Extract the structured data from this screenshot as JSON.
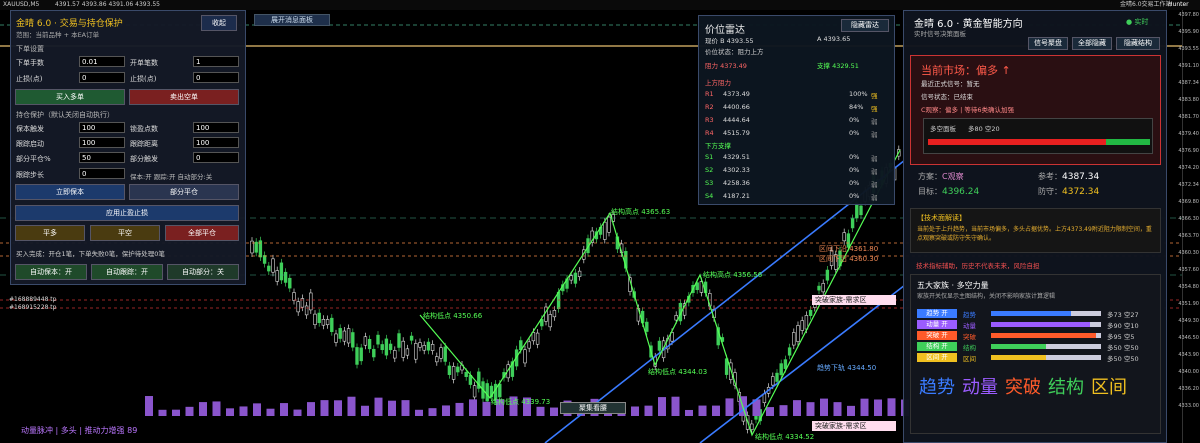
{
  "top_bar": {
    "symbol": "XAUUSD,M5",
    "ohlc": "4391.57 4393.86 4391.06 4393.55",
    "right_text": "金晴6.0交易工作站",
    "user": "Hunter"
  },
  "price_axis": [
    "4397.80",
    "4395.90",
    "4393.55",
    "4391.10",
    "4387.34",
    "4383.80",
    "4381.70",
    "4379.40",
    "4376.90",
    "4374.20",
    "4372.34",
    "4369.80",
    "4366.30",
    "4363.70",
    "4360.30",
    "4357.60",
    "4354.80",
    "4351.90",
    "4349.30",
    "4346.50",
    "4343.90",
    "4340.00",
    "4336.20",
    "4333.00"
  ],
  "left_panel": {
    "title": "金晴 6.0 · 交易与持仓保护",
    "subtitle": "范围：当前品种 + 本EA订单",
    "collapse_btn": "收起",
    "order_section": "下单设置",
    "lot_label": "下单手数",
    "lot_value": "0.01",
    "count_label": "开单笔数",
    "count_value": "1",
    "sl_label": "止损(点)",
    "sl_value": "0",
    "tp_label": "止损(点)",
    "tp_value": "0",
    "buy_btn": "买入多单",
    "sell_btn": "卖出空单",
    "protect_section": "持仓保护（默认关闭自动执行）",
    "be_trigger_label": "保本触发",
    "be_trigger_value": "100",
    "lock_label": "锁盈点数",
    "lock_value": "100",
    "trail_start_label": "跟踪启动",
    "trail_start_value": "100",
    "trail_dist_label": "跟踪距离",
    "trail_dist_value": "100",
    "partial_pct_label": "部分平仓%",
    "partial_pct_value": "50",
    "partial_trigger_label": "部分触发",
    "partial_trigger_value": "0",
    "trail_step_label": "跟踪步长",
    "trail_step_value": "0",
    "status_line": "保本:开 跟踪:开 自动部分:关",
    "be_btn": "立即保本",
    "partial_btn": "部分平仓",
    "apply_btn": "应用止盈止损",
    "close_long": "平多",
    "close_short": "平空",
    "close_all": "全部平仓",
    "log": "买入完成：开仓1笔，下单失败0笔，保护待处理0笔",
    "auto_be": "自动保本：开",
    "auto_trail": "自动跟踪：开",
    "auto_partial": "自动部分：关"
  },
  "radar": {
    "title": "价位雷达",
    "hide_btn": "隐藏雷达",
    "bid": "现价 B 4393.55",
    "ask": "A 4393.65",
    "status": "价位状态：阻力上方",
    "resistance": "阻力 4373.49",
    "support": "支撑 4329.51",
    "up_header": "上方阻力",
    "down_header": "下方支撑",
    "up": [
      {
        "name": "R1",
        "price": "4373.49",
        "pct": "100%",
        "s": "强"
      },
      {
        "name": "R2",
        "price": "4400.66",
        "pct": "84%",
        "s": "强"
      },
      {
        "name": "R3",
        "price": "4444.64",
        "pct": "0%",
        "s": "弱"
      },
      {
        "name": "R4",
        "price": "4515.79",
        "pct": "0%",
        "s": "弱"
      }
    ],
    "down": [
      {
        "name": "S1",
        "price": "4329.51",
        "pct": "0%",
        "s": "弱"
      },
      {
        "name": "S2",
        "price": "4302.33",
        "pct": "0%",
        "s": "弱"
      },
      {
        "name": "S3",
        "price": "4258.36",
        "pct": "0%",
        "s": "弱"
      },
      {
        "name": "S4",
        "price": "4187.21",
        "pct": "0%",
        "s": "弱"
      }
    ]
  },
  "right_panel": {
    "title": "金晴 6.0 · 黄金智能方向",
    "realtime": "● 实时",
    "subtitle": "实时信号决策面板",
    "btn_signal": "信号聚盘",
    "btn_hide_all": "全部隐藏",
    "btn_hide_struct": "隐藏结构",
    "market_label": "当前市场：偏多 ↑",
    "latest_signal": "最近正式信号：暂无",
    "signal_status": "信号状态：已结束",
    "c_view": "C观察：偏多 | 等待6类确认加强",
    "ls_label": "多空面板",
    "ls_value": "多80 空20",
    "long_ratio": 0.8,
    "scheme_label": "方案：",
    "scheme_value": "C观察",
    "ref_label": "参考：",
    "ref_value": "4387.34",
    "target_label": "目标：",
    "target_value": "4396.24",
    "defense_label": "防守：",
    "defense_value": "4372.34",
    "tech_title": "【技术面解读】",
    "tech_text": "当前处于上升趋势，当前市场偏多，多头占据优势。上方4373.49附近阻力限制空间，重点观察突破或防守失守确认。",
    "disclaimer": "技术指标辅助，历史不代表未来，风险自担",
    "five_title": "五大家族 · 多空力量",
    "five_sub": "家族开关仅显示主图结构，关闭不影响家族计算逻辑",
    "families": [
      {
        "name": "趋势",
        "toggle": "开",
        "label": "趋势",
        "long": 0.73,
        "text": "多73 空27",
        "color": "#3a7bff"
      },
      {
        "name": "动量",
        "toggle": "开",
        "label": "动量",
        "long": 0.9,
        "text": "多90 空10",
        "color": "#9b5cff"
      },
      {
        "name": "突破",
        "toggle": "开",
        "label": "突破",
        "long": 0.95,
        "text": "多95 空5",
        "color": "#ff5a2a"
      },
      {
        "name": "结构",
        "toggle": "开",
        "label": "结构",
        "long": 0.5,
        "text": "多50 空50",
        "color": "#3fcf5a"
      },
      {
        "name": "区间",
        "toggle": "开",
        "label": "区间",
        "long": 0.5,
        "text": "多50 空50",
        "color": "#f0c020"
      }
    ],
    "big_words": [
      "趋势",
      "动量",
      "突破",
      "结构",
      "区间"
    ]
  },
  "chart_labels": {
    "dashboard_tag": "展开消息面板",
    "struct_high1": "结构高点 4365.63",
    "struct_high2": "结构高点 4356.56",
    "struct_low1": "结构低点 4350.66",
    "struct_low2": "结构低点 4339.73",
    "struct_low3": "结构低点 4344.03",
    "struct_low4": "结构低点 4334.52",
    "zone1": "突破家族-需求区",
    "zone2": "突破家族-需求区",
    "channel_low": "趋势下轨 4344.50",
    "range_high": "区间下沿 4361.80",
    "range_low": "区间下沿 4360.30",
    "center_tag": "聚集看腰",
    "order1": "#168889448 tp",
    "order2": "#168915228 tp",
    "bottom_status": "动量脉冲 | 多头 | 推动力增强 89"
  },
  "colors": {
    "bull": "#3fcf5a",
    "bear": "#ffffff",
    "accent_red": "#e84040",
    "gold": "#f0c020"
  }
}
